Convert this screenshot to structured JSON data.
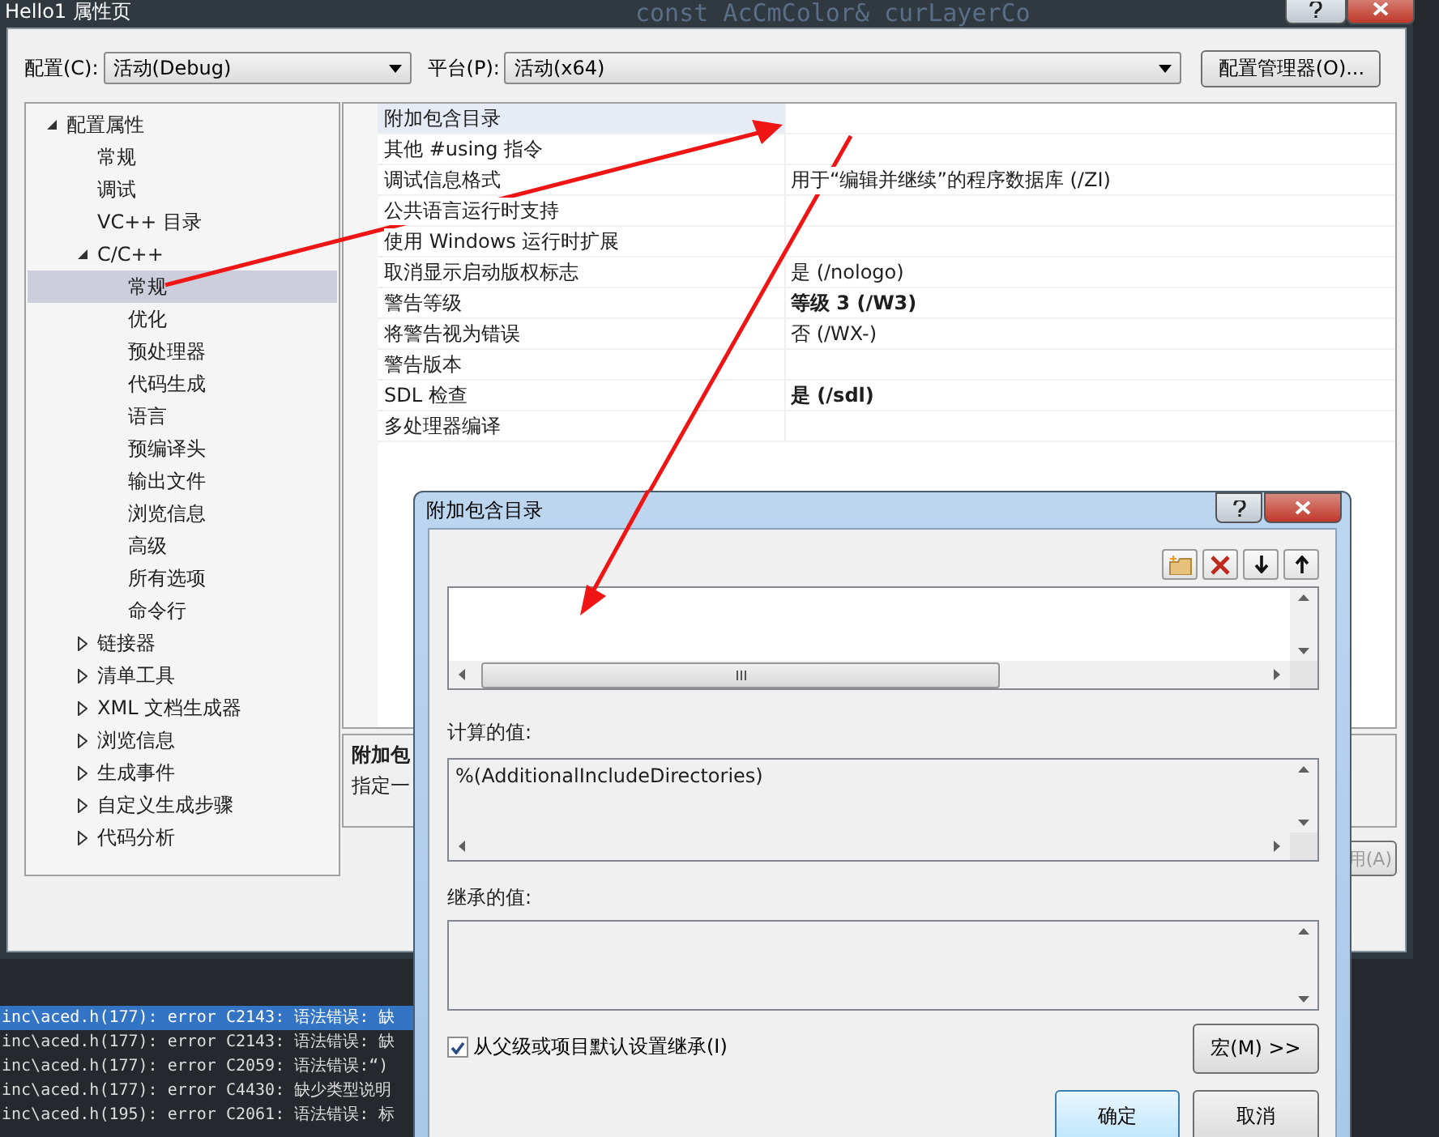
{
  "background_code": {
    "top_line": "const AcCmColor& curLayerCo",
    "output_lines": [
      {
        "text": "inc\\aced.h(177): error C2143: 语法错误: 缺",
        "selected": true
      },
      {
        "text": "inc\\aced.h(177): error C2143: 语法错误: 缺",
        "selected": false
      },
      {
        "text": "inc\\aced.h(177): error C2059: 语法错误:“)",
        "selected": false
      },
      {
        "text": "inc\\aced.h(177): error C4430: 缺少类型说明",
        "selected": false
      },
      {
        "text": "inc\\aced.h(195): error C2061: 语法错误: 标",
        "selected": false
      }
    ]
  },
  "window": {
    "title": "Hello1 属性页",
    "config_bar": {
      "config_label": "配置(C):",
      "config_value": "活动(Debug)",
      "platform_label": "平台(P):",
      "platform_value": "活动(x64)",
      "manager_button": "配置管理器(O)..."
    },
    "tree": [
      {
        "label": "配置属性",
        "expanded": true,
        "selected": false,
        "children": [
          {
            "label": "常规",
            "selected": false
          },
          {
            "label": "调试",
            "selected": false
          },
          {
            "label": "VC++ 目录",
            "selected": false
          },
          {
            "label": "C/C++",
            "expanded": true,
            "selected": false,
            "children": [
              {
                "label": "常规",
                "selected": true
              },
              {
                "label": "优化",
                "selected": false
              },
              {
                "label": "预处理器",
                "selected": false
              },
              {
                "label": "代码生成",
                "selected": false
              },
              {
                "label": "语言",
                "selected": false
              },
              {
                "label": "预编译头",
                "selected": false
              },
              {
                "label": "输出文件",
                "selected": false
              },
              {
                "label": "浏览信息",
                "selected": false
              },
              {
                "label": "高级",
                "selected": false
              },
              {
                "label": "所有选项",
                "selected": false
              },
              {
                "label": "命令行",
                "selected": false
              }
            ]
          },
          {
            "label": "链接器",
            "expanded": false,
            "selected": false
          },
          {
            "label": "清单工具",
            "expanded": false,
            "selected": false
          },
          {
            "label": "XML 文档生成器",
            "expanded": false,
            "selected": false
          },
          {
            "label": "浏览信息",
            "expanded": false,
            "selected": false
          },
          {
            "label": "生成事件",
            "expanded": false,
            "selected": false
          },
          {
            "label": "自定义生成步骤",
            "expanded": false,
            "selected": false
          },
          {
            "label": "代码分析",
            "expanded": false,
            "selected": false
          }
        ]
      }
    ],
    "properties": [
      {
        "name": "附加包含目录",
        "selected": true
      },
      {
        "name": "其他 #using 指令",
        "selected": false
      },
      {
        "name": "调试信息格式",
        "value": "用于“编辑并继续”的程序数据库 (/ZI)",
        "bold": false,
        "selected": false
      },
      {
        "name": "公共语言运行时支持",
        "selected": false
      },
      {
        "name": "使用 Windows 运行时扩展",
        "selected": false
      },
      {
        "name": "取消显示启动版权标志",
        "value": "是 (/nologo)",
        "bold": false,
        "selected": false
      },
      {
        "name": "警告等级",
        "value": "等级 3 (/W3)",
        "bold": true,
        "selected": false
      },
      {
        "name": "将警告视为错误",
        "value": "否 (/WX-)",
        "bold": false,
        "selected": false
      },
      {
        "name": "警告版本",
        "selected": false
      },
      {
        "name": "SDL 检查",
        "value": "是 (/sdl)",
        "bold": true,
        "selected": false
      },
      {
        "name": "多处理器编译",
        "selected": false
      }
    ],
    "description": {
      "title": "附加包",
      "text": "指定一"
    },
    "apply_button": {
      "label": "用(A)",
      "disabled": true
    }
  },
  "dialog": {
    "title": "附加包含目录",
    "computed_label": "计算的值:",
    "computed_value": "%(AdditionalIncludeDirectories)",
    "inherited_label": "继承的值:",
    "inherit_checkbox": {
      "label": "从父级或项目默认设置继承(I)",
      "checked": true
    },
    "macro_button": "宏(M) >>",
    "ok_button": "确定",
    "cancel_button": "取消"
  }
}
